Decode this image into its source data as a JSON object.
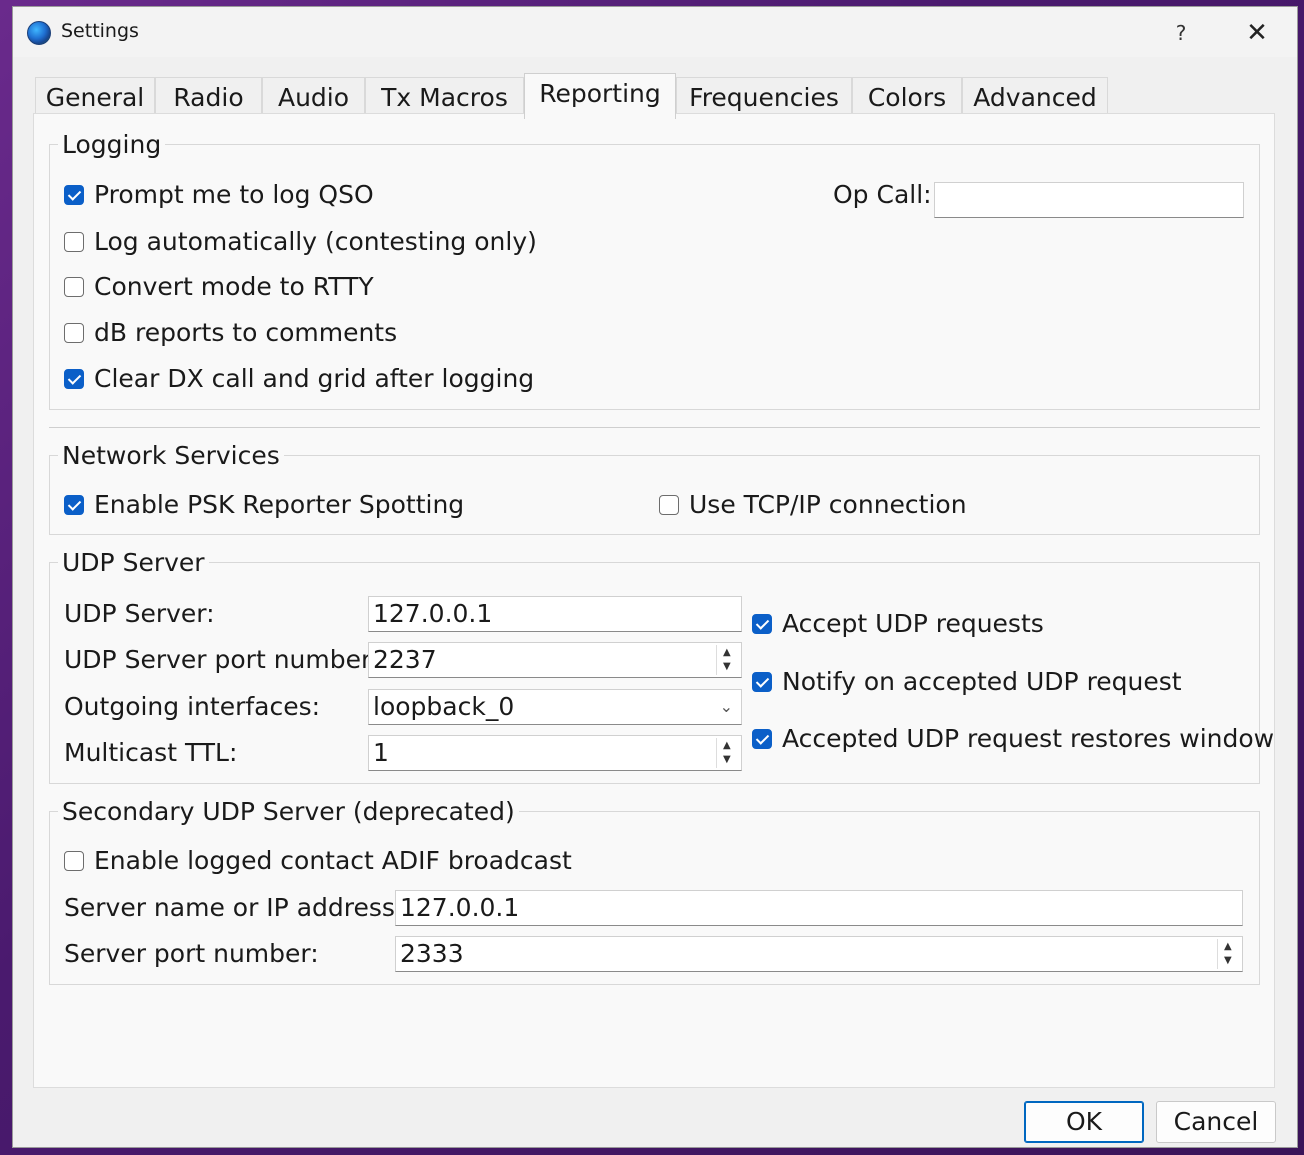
{
  "window": {
    "title": "Settings",
    "help_glyph": "?",
    "close_glyph": "✕"
  },
  "tabs": [
    "General",
    "Radio",
    "Audio",
    "Tx Macros",
    "Reporting",
    "Frequencies",
    "Colors",
    "Advanced"
  ],
  "active_tab": "Reporting",
  "logging": {
    "title": "Logging",
    "prompt_log": {
      "label": "Prompt me to log QSO",
      "checked": true
    },
    "log_auto": {
      "label": "Log automatically (contesting only)",
      "checked": false
    },
    "convert_rtty": {
      "label": "Convert mode to RTTY",
      "checked": false
    },
    "db_reports": {
      "label": "dB reports to comments",
      "checked": false
    },
    "clear_dx": {
      "label": "Clear DX call and grid after logging",
      "checked": true
    },
    "op_call_label": "Op Call:",
    "op_call_value": ""
  },
  "network": {
    "title": "Network Services",
    "psk_reporter": {
      "label": "Enable PSK Reporter Spotting",
      "checked": true
    },
    "tcp_ip": {
      "label": "Use TCP/IP connection",
      "checked": false
    }
  },
  "udp": {
    "title": "UDP Server",
    "server_label": "UDP Server:",
    "server_value": "127.0.0.1",
    "port_label": "UDP Server port number:",
    "port_value": "2237",
    "iface_label": "Outgoing interfaces:",
    "iface_value": "loopback_0",
    "ttl_label": "Multicast TTL:",
    "ttl_value": "1",
    "accept": {
      "label": "Accept UDP requests",
      "checked": true
    },
    "notify": {
      "label": "Notify on accepted UDP request",
      "checked": true
    },
    "restore": {
      "label": "Accepted UDP request restores window",
      "checked": true
    }
  },
  "secondary": {
    "title": "Secondary UDP Server (deprecated)",
    "adif": {
      "label": "Enable logged contact ADIF broadcast",
      "checked": false
    },
    "name_label": "Server name or IP address:",
    "name_value": "127.0.0.1",
    "port_label": "Server port number:",
    "port_value": "2333"
  },
  "buttons": {
    "ok": "OK",
    "cancel": "Cancel"
  }
}
